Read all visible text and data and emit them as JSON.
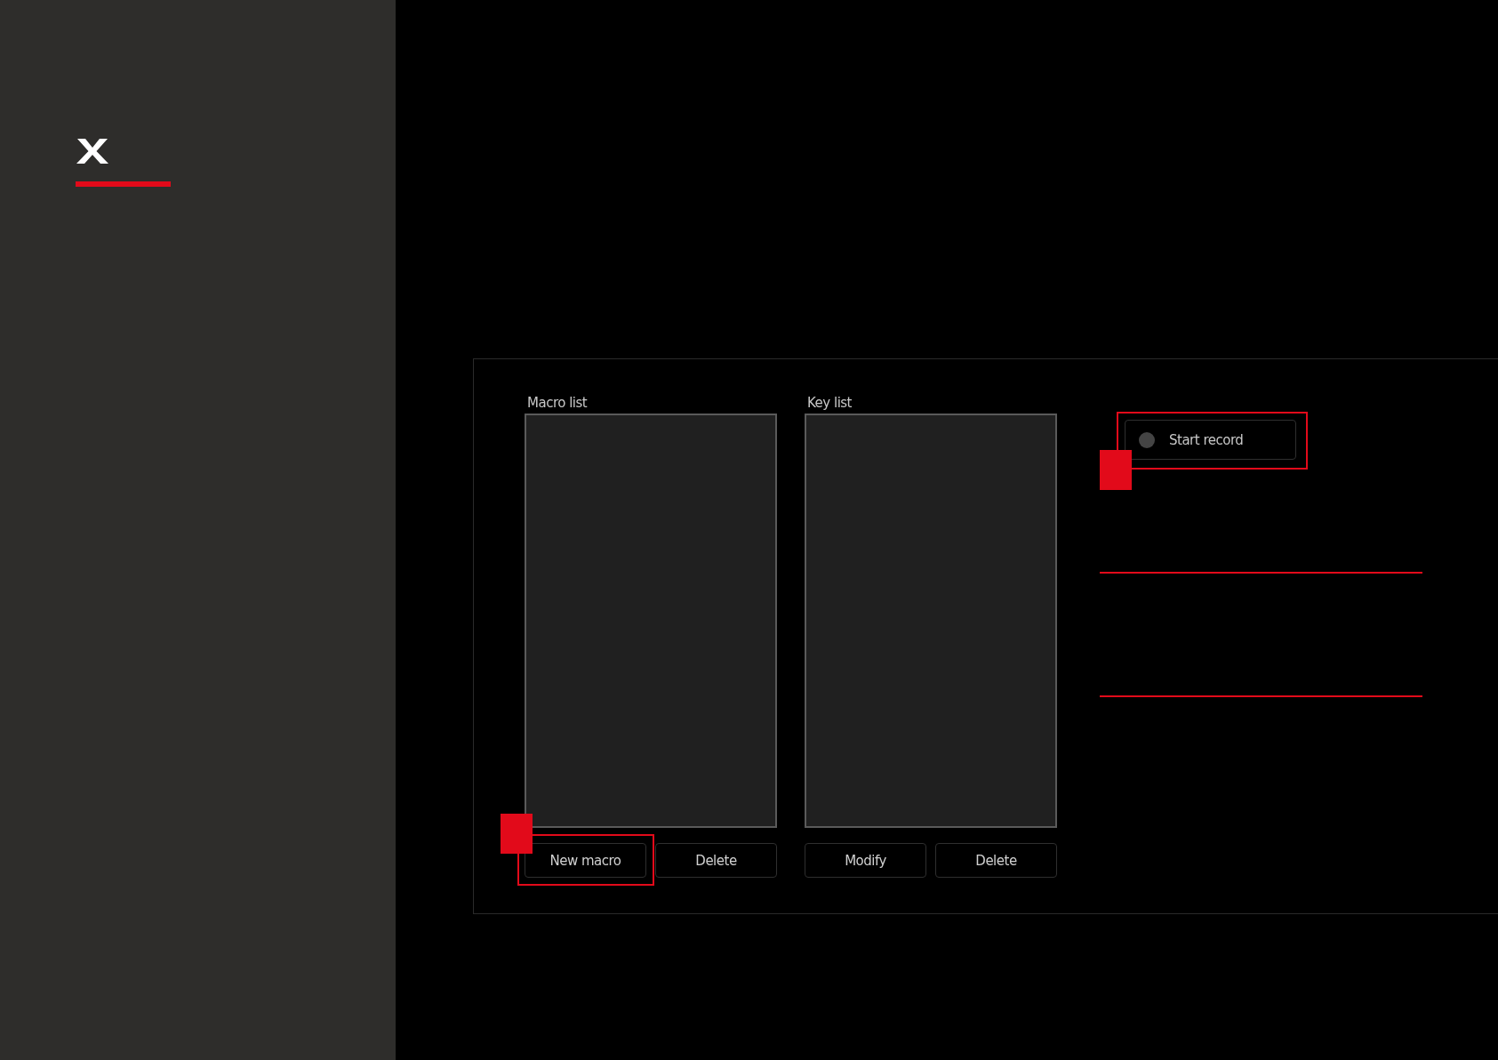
{
  "macro_window": {
    "lists": [
      {
        "label": "Macro list",
        "buttons": [
          {
            "label": "New macro",
            "highlighted": true
          },
          {
            "label": "Delete",
            "highlighted": false
          }
        ]
      },
      {
        "label": "Key list",
        "buttons": [
          {
            "label": "Modify",
            "highlighted": false
          },
          {
            "label": "Delete",
            "highlighted": false
          }
        ]
      }
    ],
    "record_button": {
      "label": "Start record",
      "highlighted": true
    }
  }
}
